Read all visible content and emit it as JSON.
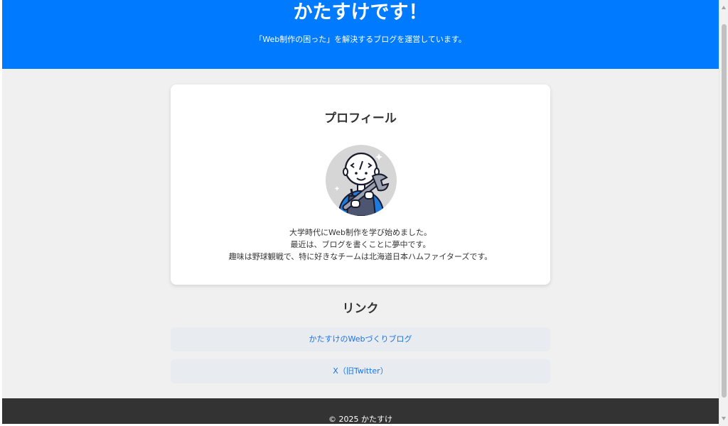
{
  "header": {
    "title": "かたすけです！",
    "description": "「Web制作の困った」を解決するブログを運営しています。",
    "bg_color": "#007bff"
  },
  "profile": {
    "heading": "プロフィール",
    "avatar_icon": "developer-with-wrench-avatar",
    "bio_lines": [
      "大学時代にWeb制作を学び始めました。",
      "最近は、ブログを書くことに夢中です。",
      "趣味は野球観戦で、特に好きなチームは北海道日本ハムファイターズです。"
    ]
  },
  "links": {
    "heading": "リンク",
    "items": [
      {
        "label": "かたすけのWebづくりブログ"
      },
      {
        "label": "X（旧Twitter）"
      }
    ],
    "link_color": "#1a73e8"
  },
  "footer": {
    "copyright": "© 2025 かたすけ"
  }
}
